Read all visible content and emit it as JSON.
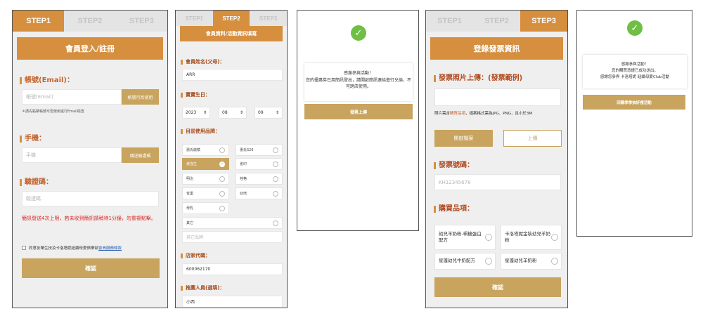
{
  "panel1": {
    "tabs": [
      "STEP1",
      "STEP2",
      "STEP3"
    ],
    "active_tab": 0,
    "banner": "會員登入/註冊",
    "account_label": "帳號(Email)：",
    "account_placeholder": "帳號(Email)",
    "account_check_btn": "帳號可否使用",
    "account_note": "＊請先點擊帳號可否使用進行Email檢查",
    "phone_label": "手機：",
    "phone_placeholder": "手機",
    "send_code_btn": "傳送驗證碼",
    "code_label": "驗證碼：",
    "code_placeholder": "驗證碼",
    "sms_warning": "簡訊發送4次上限，若未收到簡訊請稍待1分鐘，勿重複點擊。",
    "agree_text": "同意友華生技及卡洛塔妮紐續母愛俱樂部",
    "agree_link": "會員服務條款",
    "confirm_btn": "確認"
  },
  "panel2": {
    "tabs": [
      "STEP1",
      "STEP2",
      "STEP3"
    ],
    "active_tab": 1,
    "banner": "會員資料/活動資訊填寫",
    "name_label": "會員姓名(父母)：",
    "name_value": "ARR",
    "birth_label": "寶寶生日：",
    "birth_year": "2023",
    "birth_month": "08",
    "birth_day": "09",
    "brand_label": "目前使用品牌：",
    "brands": [
      {
        "name": "惠氏啟賦",
        "selected": false
      },
      {
        "name": "惠氏S26",
        "selected": false
      },
      {
        "name": "美強生",
        "selected": true
      },
      {
        "name": "雀印",
        "selected": false
      },
      {
        "name": "明治",
        "selected": false
      },
      {
        "name": "桂格",
        "selected": false
      },
      {
        "name": "雀巢",
        "selected": false
      },
      {
        "name": "亞培",
        "selected": false
      },
      {
        "name": "母乳",
        "selected": false
      }
    ],
    "other_label": "其它",
    "other_placeholder": "其它品牌",
    "store_label": "店家代碼：",
    "store_value": "600062170",
    "referrer_label": "推薦人員(選填)：",
    "referrer_value": "小西"
  },
  "panel3": {
    "message": "感謝參與活動！\n您的優惠券已用簡訊發出，請開啟簡訊連結進行兌換，不可跨店使用。",
    "upload_btn": "發票上傳"
  },
  "panel4": {
    "tabs": [
      "STEP1",
      "STEP2",
      "STEP3"
    ],
    "active_tab": 2,
    "banner": "登錄發票資訊",
    "photo_label": "發票照片上傳：",
    "photo_link": "(發票範例)",
    "photo_note_prefix": "照片需含",
    "photo_note_highlight": "購買品項",
    "photo_note_suffix": "，檔案格式需為JPG、PNG，且小於3M",
    "open_file_btn": "開啟檔案",
    "upload_btn": "上傳",
    "invoice_label": "發票號碼：",
    "invoice_placeholder": "KH12345678",
    "items_label": "購買品項：",
    "items": [
      "幼兒羊奶粉-珮糖蛋白配方",
      "卡洛塔妮金裝幼兒羊奶粉",
      "星護幼兒牛奶配方",
      "星護幼兒羊奶粉"
    ],
    "confirm_btn": "確認"
  },
  "panel5": {
    "message": "感謝參與活動！\n您的購買憑證已成功送出。\n感謝您參與 卡洛塔妮 紐續母愛Club活動",
    "back_btn": "回購季季抽好禮活動"
  }
}
